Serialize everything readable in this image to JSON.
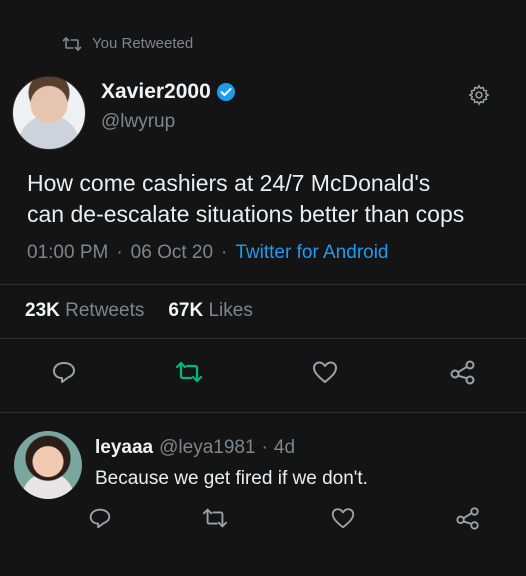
{
  "retweet_banner": {
    "icon": "retweet-icon",
    "label": "You Retweeted"
  },
  "tweet": {
    "author_name": "Xavier2000",
    "author_handle": "@lwyrup",
    "verified_icon": "verified-badge-icon",
    "text_line1": "How come cashiers at 24/7 McDonald's",
    "text_line2": "can de-escalate situations better than cops",
    "time": "01:00 PM",
    "sep1": "·",
    "date": "06 Oct 20",
    "sep2": "·",
    "source": "Twitter for Android",
    "retweets_count": "23K",
    "retweets_label": "Retweets",
    "likes_count": "67K",
    "likes_label": "Likes"
  },
  "reply": {
    "name": "leyaaa",
    "handle": "@leya1981",
    "sep": "·",
    "age": "4d",
    "text": "Because we get fired if we don't."
  },
  "colors": {
    "background": "#141414",
    "accent": "#1d9bf0",
    "retweet_active": "#00ba7c",
    "muted": "#7c8690"
  }
}
